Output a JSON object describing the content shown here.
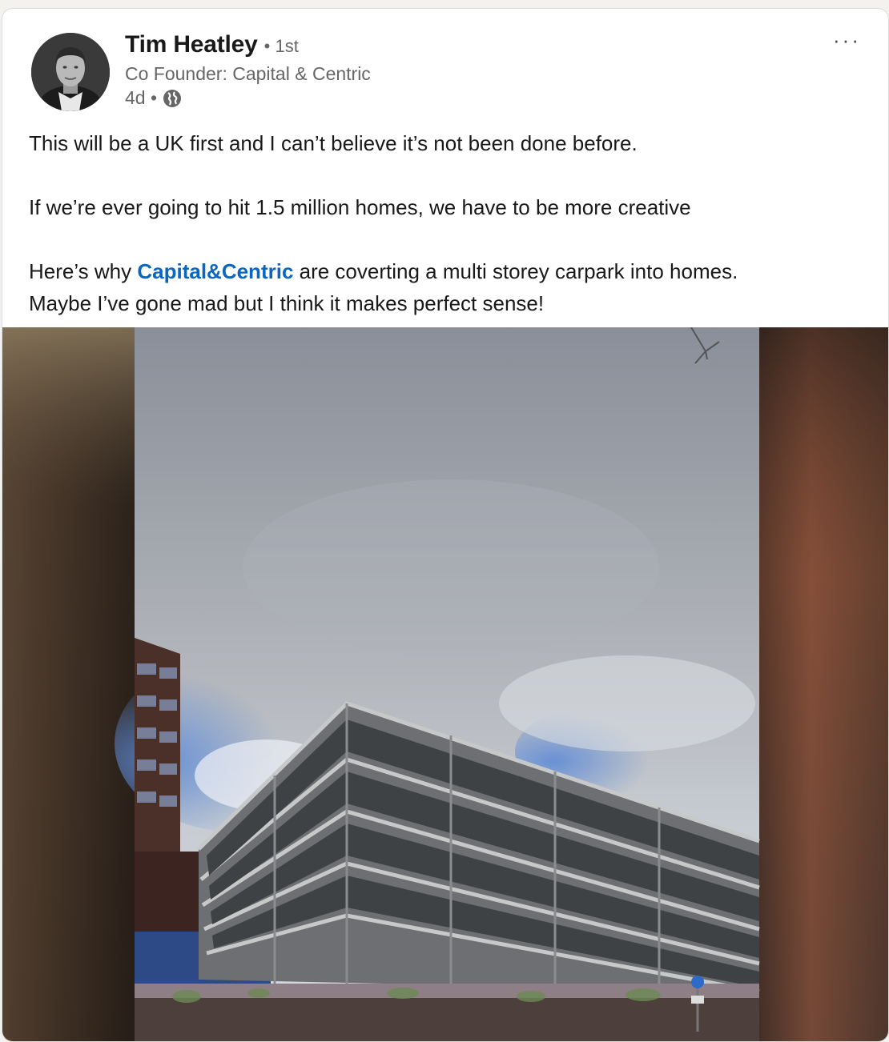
{
  "post": {
    "author": {
      "name": "Tim Heatley",
      "degree": "• 1st",
      "headline": "Co Founder: Capital & Centric",
      "timestamp": "4d •",
      "visibility_icon": "globe-icon"
    },
    "more_label": "···",
    "text": {
      "line1": "This will be a UK first and I can’t believe it’s not been done before.",
      "line2": "If we’re ever going to hit 1.5 million homes, we have to be more creative",
      "line3_prefix": "Here’s why ",
      "mention": "Capital&Centric",
      "line3_suffix": " are coverting a multi storey carpark into homes.",
      "line4": "Maybe I’ve gone mad but I think it makes perfect sense!"
    },
    "media": {
      "type": "video",
      "subject": "multi-storey-carpark"
    },
    "colors": {
      "mention": "#0a66c2",
      "muted": "#666666"
    }
  }
}
